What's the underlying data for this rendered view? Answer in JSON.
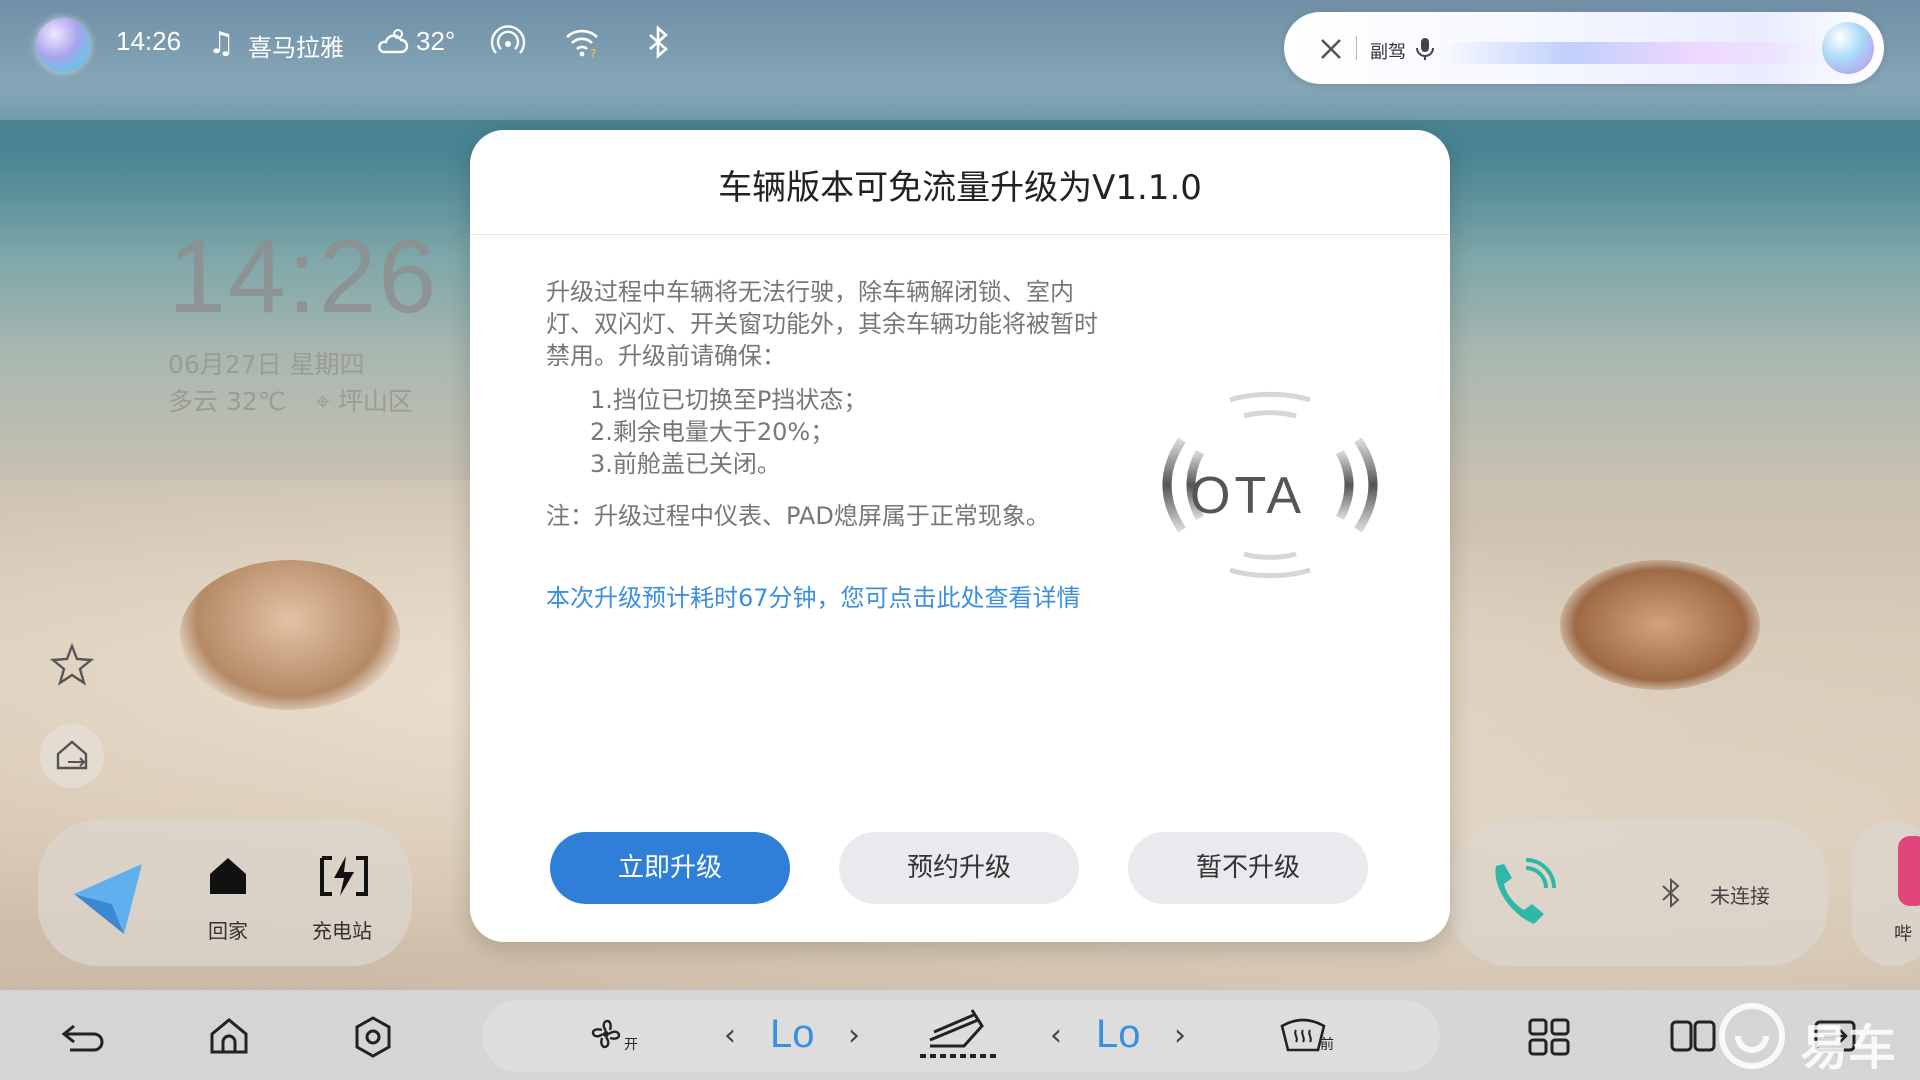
{
  "status_bar": {
    "time": "14:26",
    "media": "喜马拉雅",
    "temperature": "32°",
    "icons": [
      "assistant-orb-icon",
      "music-note-icon",
      "weather-cloud-sun-icon",
      "hotspot-icon",
      "wifi-icon",
      "bluetooth-icon"
    ]
  },
  "assistant_bar": {
    "mode_label": "副驾",
    "icons": [
      "close-icon",
      "mic-icon"
    ]
  },
  "home_widget": {
    "clock": "14:26",
    "date": "06月27日  星期四",
    "weather": "多云  32℃",
    "location": "坪山区"
  },
  "nav_card": {
    "home_label": "回家",
    "charging_label": "充电站"
  },
  "music_card": {
    "bluetooth_status": "未连接",
    "app_label": "哔"
  },
  "dialog": {
    "title": "车辆版本可免流量升级为V1.1.0",
    "intro": "升级过程中车辆将无法行驶，除车辆解闭锁、室内灯、双闪灯、开关窗功能外，其余车辆功能将被暂时禁用。升级前请确保：",
    "conditions": [
      "1.挡位已切换至P挡状态；",
      "2.剩余电量大于20%；",
      "3.前舱盖已关闭。"
    ],
    "note": "注：升级过程中仪表、PAD熄屏属于正常现象。",
    "link": "本次升级预计耗时67分钟，您可点击此处查看详情",
    "badge_text": "OTA",
    "buttons": {
      "upgrade_now": "立即升级",
      "schedule": "预约升级",
      "later": "暂不升级"
    }
  },
  "dock": {
    "fan_label": "开",
    "left_temp": "Lo",
    "right_temp": "Lo",
    "defrost_label": "前"
  },
  "watermark": "易车",
  "colors": {
    "accent": "#2f7fd8",
    "link": "#3b8fe0",
    "dialog_bg": "#ffffff",
    "secondary_button": "#e9eaee"
  }
}
